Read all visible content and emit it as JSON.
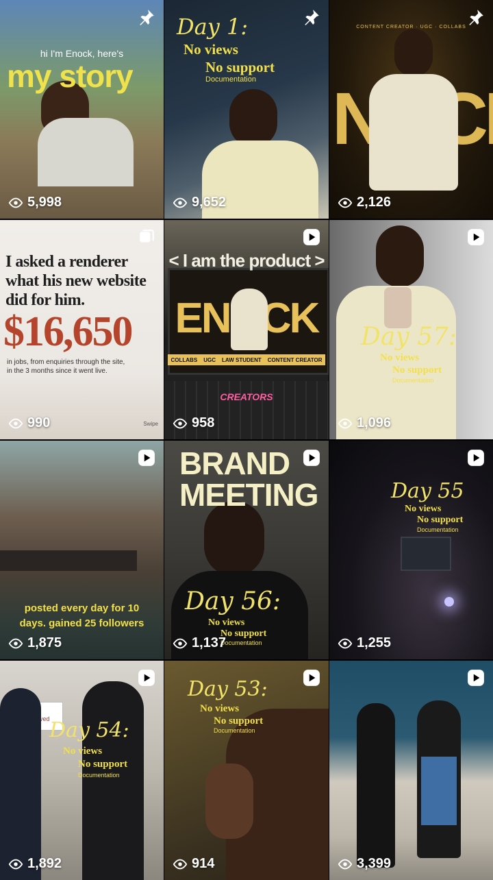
{
  "posts": [
    {
      "views": "5,998",
      "badge": "pin-icon",
      "lines": [
        "hi I'm Enock, here's",
        "my story"
      ]
    },
    {
      "views": "9,652",
      "badge": "pin-icon",
      "lines": [
        "Day 1:",
        "No views",
        "No support",
        "Documentation"
      ]
    },
    {
      "views": "2,126",
      "badge": "pin-icon",
      "lines": [
        "CONTENT CREATOR  ·  UGC  ·  COLLABS",
        "NOCK"
      ]
    },
    {
      "views": "990",
      "badge": "carousel-icon",
      "lines": [
        "I asked a renderer",
        "what his new website",
        "did for him.",
        "$16,650",
        "in jobs, from enquiries through the site,",
        "in the 3 months since it went live.",
        "Swipe"
      ]
    },
    {
      "views": "958",
      "badge": "reel-icon",
      "lines": [
        "< I am the product >",
        "ENOCK",
        "COLLABS",
        "UGC",
        "LAW STUDENT",
        "CONTENT CREATOR",
        "CREATORS"
      ]
    },
    {
      "views": "1,096",
      "badge": "reel-icon",
      "lines": [
        "Day 57:",
        "No views",
        "No support",
        "Documentation"
      ]
    },
    {
      "views": "1,875",
      "badge": "reel-icon",
      "lines": [
        "posted every day for 10",
        "days. gained 25 followers"
      ]
    },
    {
      "views": "1,137",
      "badge": "reel-icon",
      "lines": [
        "BRAND",
        "MEETING",
        "Day 56:",
        "No views",
        "No support",
        "Documentation"
      ]
    },
    {
      "views": "1,255",
      "badge": "reel-icon",
      "lines": [
        "Day 55",
        "No views",
        "No support",
        "Documentation"
      ]
    },
    {
      "views": "1,892",
      "badge": "reel-icon",
      "lines": [
        "Day 54:",
        "No views",
        "No support",
        "Documentation",
        "Reserved"
      ]
    },
    {
      "views": "914",
      "badge": "reel-icon",
      "lines": [
        "Day 53:",
        "No views",
        "No support",
        "Documentation"
      ]
    },
    {
      "views": "3,399",
      "badge": "reel-icon",
      "lines": []
    }
  ],
  "colors": {
    "accent_yellow": "#f2e04a",
    "gold": "#e8c15a",
    "rust": "#b4452c"
  }
}
